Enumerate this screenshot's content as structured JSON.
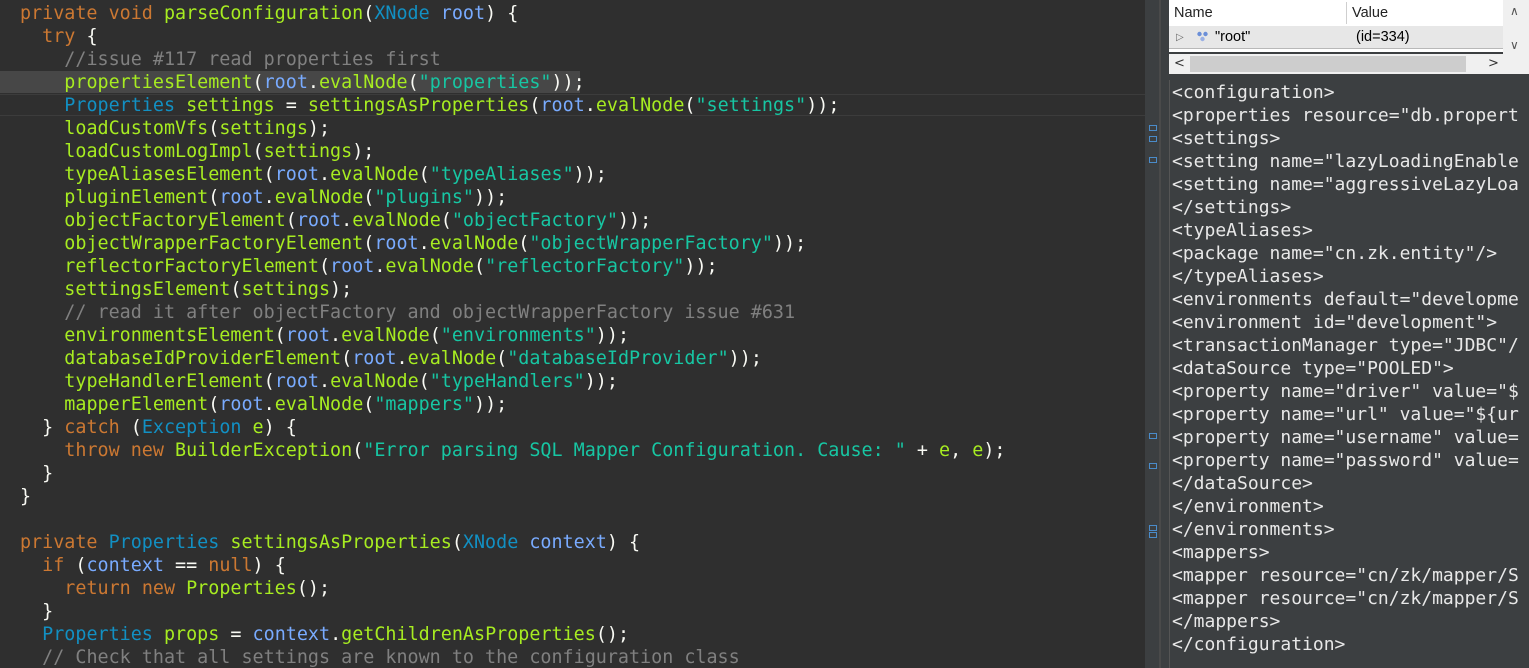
{
  "editor": {
    "lines": [
      [
        [
          "kw",
          "private "
        ],
        [
          "kw",
          "void "
        ],
        [
          "fn",
          "parseConfiguration"
        ],
        [
          "pl",
          "("
        ],
        [
          "ty",
          "XNode "
        ],
        [
          "var",
          "root"
        ],
        [
          "pl",
          ") {"
        ]
      ],
      [
        [
          "pl",
          "  "
        ],
        [
          "kw",
          "try "
        ],
        [
          "pl",
          "{"
        ]
      ],
      [
        [
          "pl",
          "    "
        ],
        [
          "cm",
          "//issue #117 read properties first"
        ]
      ],
      [
        [
          "pl",
          "    "
        ],
        [
          "fn",
          "propertiesElement"
        ],
        [
          "pl",
          "("
        ],
        [
          "var",
          "root"
        ],
        [
          "pl",
          "."
        ],
        [
          "fn",
          "evalNode"
        ],
        [
          "pl",
          "("
        ],
        [
          "str",
          "\"properties\""
        ],
        [
          "pl",
          "));"
        ]
      ],
      [
        [
          "pl",
          "    "
        ],
        [
          "ty",
          "Properties "
        ],
        [
          "fn",
          "settings "
        ],
        [
          "pl",
          "= "
        ],
        [
          "fn",
          "settingsAsProperties"
        ],
        [
          "pl",
          "("
        ],
        [
          "var",
          "root"
        ],
        [
          "pl",
          "."
        ],
        [
          "fn",
          "evalNode"
        ],
        [
          "pl",
          "("
        ],
        [
          "str",
          "\"settings\""
        ],
        [
          "pl",
          "));"
        ]
      ],
      [
        [
          "pl",
          "    "
        ],
        [
          "fn",
          "loadCustomVfs"
        ],
        [
          "pl",
          "("
        ],
        [
          "fn",
          "settings"
        ],
        [
          "pl",
          ");"
        ]
      ],
      [
        [
          "pl",
          "    "
        ],
        [
          "fn",
          "loadCustomLogImpl"
        ],
        [
          "pl",
          "("
        ],
        [
          "fn",
          "settings"
        ],
        [
          "pl",
          ");"
        ]
      ],
      [
        [
          "pl",
          "    "
        ],
        [
          "fn",
          "typeAliasesElement"
        ],
        [
          "pl",
          "("
        ],
        [
          "var",
          "root"
        ],
        [
          "pl",
          "."
        ],
        [
          "fn",
          "evalNode"
        ],
        [
          "pl",
          "("
        ],
        [
          "str",
          "\"typeAliases\""
        ],
        [
          "pl",
          "));"
        ]
      ],
      [
        [
          "pl",
          "    "
        ],
        [
          "fn",
          "pluginElement"
        ],
        [
          "pl",
          "("
        ],
        [
          "var",
          "root"
        ],
        [
          "pl",
          "."
        ],
        [
          "fn",
          "evalNode"
        ],
        [
          "pl",
          "("
        ],
        [
          "str",
          "\"plugins\""
        ],
        [
          "pl",
          "));"
        ]
      ],
      [
        [
          "pl",
          "    "
        ],
        [
          "fn",
          "objectFactoryElement"
        ],
        [
          "pl",
          "("
        ],
        [
          "var",
          "root"
        ],
        [
          "pl",
          "."
        ],
        [
          "fn",
          "evalNode"
        ],
        [
          "pl",
          "("
        ],
        [
          "str",
          "\"objectFactory\""
        ],
        [
          "pl",
          "));"
        ]
      ],
      [
        [
          "pl",
          "    "
        ],
        [
          "fn",
          "objectWrapperFactoryElement"
        ],
        [
          "pl",
          "("
        ],
        [
          "var",
          "root"
        ],
        [
          "pl",
          "."
        ],
        [
          "fn",
          "evalNode"
        ],
        [
          "pl",
          "("
        ],
        [
          "str",
          "\"objectWrapperFactory\""
        ],
        [
          "pl",
          "));"
        ]
      ],
      [
        [
          "pl",
          "    "
        ],
        [
          "fn",
          "reflectorFactoryElement"
        ],
        [
          "pl",
          "("
        ],
        [
          "var",
          "root"
        ],
        [
          "pl",
          "."
        ],
        [
          "fn",
          "evalNode"
        ],
        [
          "pl",
          "("
        ],
        [
          "str",
          "\"reflectorFactory\""
        ],
        [
          "pl",
          "));"
        ]
      ],
      [
        [
          "pl",
          "    "
        ],
        [
          "fn",
          "settingsElement"
        ],
        [
          "pl",
          "("
        ],
        [
          "fn",
          "settings"
        ],
        [
          "pl",
          ");"
        ]
      ],
      [
        [
          "pl",
          "    "
        ],
        [
          "cm",
          "// read it after objectFactory and objectWrapperFactory issue #631"
        ]
      ],
      [
        [
          "pl",
          "    "
        ],
        [
          "fn",
          "environmentsElement"
        ],
        [
          "pl",
          "("
        ],
        [
          "var",
          "root"
        ],
        [
          "pl",
          "."
        ],
        [
          "fn",
          "evalNode"
        ],
        [
          "pl",
          "("
        ],
        [
          "str",
          "\"environments\""
        ],
        [
          "pl",
          "));"
        ]
      ],
      [
        [
          "pl",
          "    "
        ],
        [
          "fn",
          "databaseIdProviderElement"
        ],
        [
          "pl",
          "("
        ],
        [
          "var",
          "root"
        ],
        [
          "pl",
          "."
        ],
        [
          "fn",
          "evalNode"
        ],
        [
          "pl",
          "("
        ],
        [
          "str",
          "\"databaseIdProvider\""
        ],
        [
          "pl",
          "));"
        ]
      ],
      [
        [
          "pl",
          "    "
        ],
        [
          "fn",
          "typeHandlerElement"
        ],
        [
          "pl",
          "("
        ],
        [
          "var",
          "root"
        ],
        [
          "pl",
          "."
        ],
        [
          "fn",
          "evalNode"
        ],
        [
          "pl",
          "("
        ],
        [
          "str",
          "\"typeHandlers\""
        ],
        [
          "pl",
          "));"
        ]
      ],
      [
        [
          "pl",
          "    "
        ],
        [
          "fn",
          "mapperElement"
        ],
        [
          "pl",
          "("
        ],
        [
          "var",
          "root"
        ],
        [
          "pl",
          "."
        ],
        [
          "fn",
          "evalNode"
        ],
        [
          "pl",
          "("
        ],
        [
          "str",
          "\"mappers\""
        ],
        [
          "pl",
          "));"
        ]
      ],
      [
        [
          "pl",
          "  } "
        ],
        [
          "kw",
          "catch "
        ],
        [
          "pl",
          "("
        ],
        [
          "ty",
          "Exception "
        ],
        [
          "fn",
          "e"
        ],
        [
          "pl",
          ") {"
        ]
      ],
      [
        [
          "pl",
          "    "
        ],
        [
          "kw",
          "throw "
        ],
        [
          "kw",
          "new "
        ],
        [
          "fn",
          "BuilderException"
        ],
        [
          "pl",
          "("
        ],
        [
          "str",
          "\"Error parsing SQL Mapper Configuration. Cause: \""
        ],
        [
          "pl",
          " + "
        ],
        [
          "fn",
          "e"
        ],
        [
          "pl",
          ", "
        ],
        [
          "fn",
          "e"
        ],
        [
          "pl",
          ");"
        ]
      ],
      [
        [
          "pl",
          "  }"
        ]
      ],
      [
        [
          "pl",
          "}"
        ]
      ],
      [
        [
          "pl",
          ""
        ]
      ],
      [
        [
          "kw",
          "private "
        ],
        [
          "ty",
          "Properties "
        ],
        [
          "fn",
          "settingsAsProperties"
        ],
        [
          "pl",
          "("
        ],
        [
          "ty",
          "XNode "
        ],
        [
          "var",
          "context"
        ],
        [
          "pl",
          ") {"
        ]
      ],
      [
        [
          "pl",
          "  "
        ],
        [
          "kw",
          "if "
        ],
        [
          "pl",
          "("
        ],
        [
          "var",
          "context "
        ],
        [
          "pl",
          "== "
        ],
        [
          "kw",
          "null"
        ],
        [
          "pl",
          ") {"
        ]
      ],
      [
        [
          "pl",
          "    "
        ],
        [
          "kw",
          "return "
        ],
        [
          "kw",
          "new "
        ],
        [
          "fn",
          "Properties"
        ],
        [
          "pl",
          "();"
        ]
      ],
      [
        [
          "pl",
          "  }"
        ]
      ],
      [
        [
          "pl",
          "  "
        ],
        [
          "ty",
          "Properties "
        ],
        [
          "fn",
          "props "
        ],
        [
          "pl",
          "= "
        ],
        [
          "var",
          "context"
        ],
        [
          "pl",
          "."
        ],
        [
          "fn",
          "getChildrenAsProperties"
        ],
        [
          "pl",
          "();"
        ]
      ],
      [
        [
          "pl",
          "  "
        ],
        [
          "cm",
          "// Check that all settings are known to the configuration class"
        ]
      ]
    ]
  },
  "variables": {
    "col_name": "Name",
    "col_value": "Value",
    "row_name": "\"root\"",
    "row_value": "(id=334)",
    "expander": "▷",
    "scroll_left": "<",
    "scroll_right": ">",
    "scroll_up": "∧",
    "scroll_down": "∨"
  },
  "xml_lines": [
    "<configuration>",
    "<properties resource=\"db.propert",
    "<settings>",
    "<setting name=\"lazyLoadingEnable",
    "<setting name=\"aggressiveLazyLoa",
    "</settings>",
    "<typeAliases>",
    "<package name=\"cn.zk.entity\"/>",
    "</typeAliases>",
    "<environments default=\"developme",
    "<environment id=\"development\">",
    "<transactionManager type=\"JDBC\"/",
    "<dataSource type=\"POOLED\">",
    "<property name=\"driver\" value=\"$",
    "<property name=\"url\" value=\"${ur",
    "<property name=\"username\" value=",
    "<property name=\"password\" value=",
    "</dataSource>",
    "</environment>",
    "</environments>",
    "<mappers>",
    "<mapper resource=\"cn/zk/mapper/S",
    "<mapper resource=\"cn/zk/mapper/S",
    "</mappers>",
    "</configuration>"
  ]
}
